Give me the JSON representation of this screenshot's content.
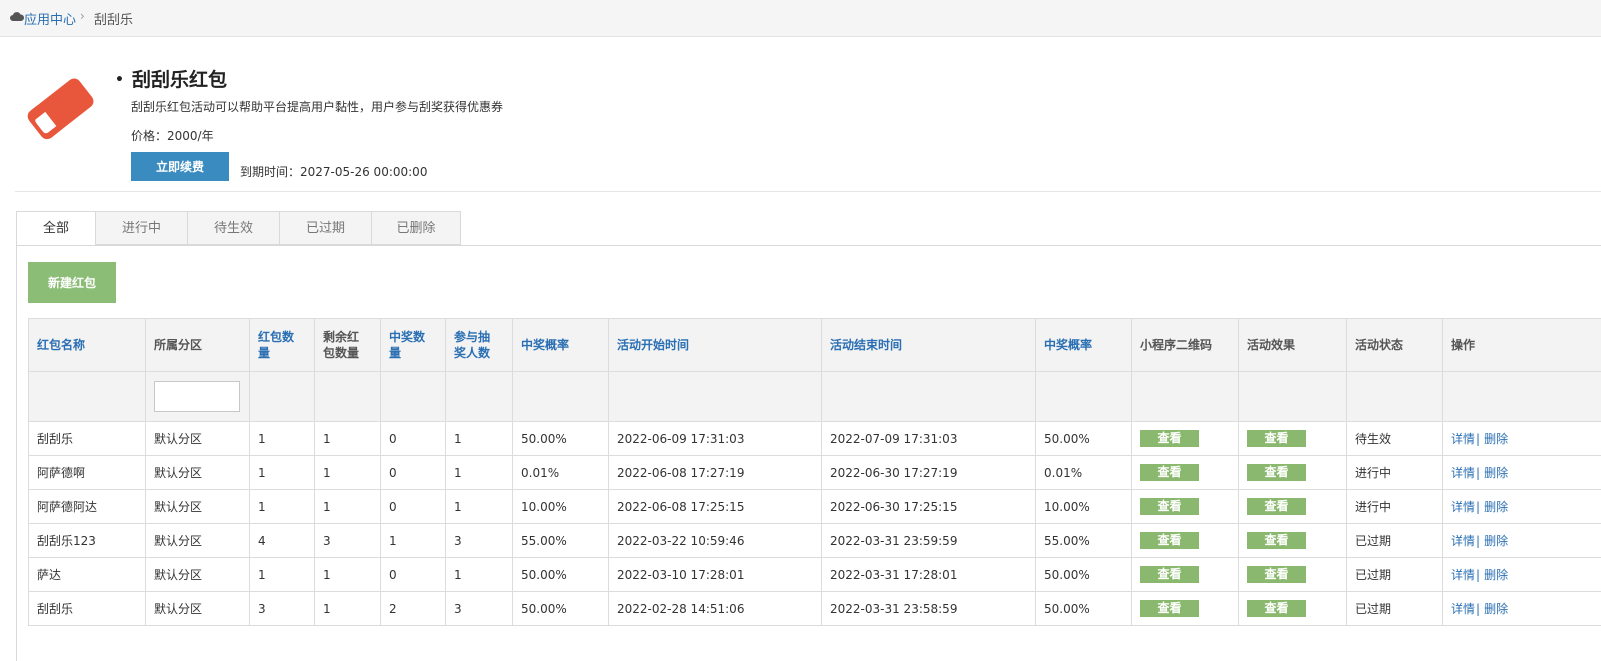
{
  "breadcrumb": {
    "home": "应用中心",
    "separator": "›",
    "current": "刮刮乐"
  },
  "app": {
    "title": "刮刮乐红包",
    "description": "刮刮乐红包活动可以帮助平台提高用户黏性，用户参与刮奖获得优惠券",
    "price": "价格：2000/年",
    "renew_label": "立即续费",
    "expire": "到期时间：2027-05-26 00:00:00",
    "logo_icon": "eraser-icon",
    "logo_color": "#e8573c"
  },
  "tabs": [
    "全部",
    "进行中",
    "待生效",
    "已过期",
    "已删除"
  ],
  "new_button": "新建红包",
  "table": {
    "headers": [
      "红包名称",
      "所属分区",
      "红包数量",
      "剩余红包数量",
      "中奖数量",
      "参与抽奖人数",
      "中奖概率",
      "活动开始时间",
      "活动结束时间",
      "中奖概率",
      "小程序二维码",
      "活动效果",
      "活动状态",
      "操作"
    ],
    "header_lines": [
      [
        "红包名称"
      ],
      [
        "所属分区"
      ],
      [
        "红包数",
        "量"
      ],
      [
        "剩余红",
        "包数量"
      ],
      [
        "中奖数",
        "量"
      ],
      [
        "参与抽",
        "奖人数"
      ],
      [
        "中奖概率"
      ],
      [
        "活动开始时间"
      ],
      [
        "活动结束时间"
      ],
      [
        "中奖概率"
      ],
      [
        "小程序二维码"
      ],
      [
        "活动效果"
      ],
      [
        "活动状态"
      ],
      [
        "操作"
      ]
    ],
    "view_label": "查看",
    "detail_label": "详情",
    "separator": "|",
    "delete_label": "删除",
    "rows": [
      [
        "刮刮乐",
        "默认分区",
        "1",
        "1",
        "0",
        "1",
        "50.00%",
        "2022-06-09 17:31:03",
        "2022-07-09 17:31:03",
        "50.00%",
        "待生效"
      ],
      [
        "阿萨德啊",
        "默认分区",
        "1",
        "1",
        "0",
        "1",
        "0.01%",
        "2022-06-08 17:27:19",
        "2022-06-30 17:27:19",
        "0.01%",
        "进行中"
      ],
      [
        "阿萨德阿达",
        "默认分区",
        "1",
        "1",
        "0",
        "1",
        "10.00%",
        "2022-06-08 17:25:15",
        "2022-06-30 17:25:15",
        "10.00%",
        "进行中"
      ],
      [
        "刮刮乐123",
        "默认分区",
        "4",
        "3",
        "1",
        "3",
        "55.00%",
        "2022-03-22 10:59:46",
        "2022-03-31 23:59:59",
        "55.00%",
        "已过期"
      ],
      [
        "萨达",
        "默认分区",
        "1",
        "1",
        "0",
        "1",
        "50.00%",
        "2022-03-10 17:28:01",
        "2022-03-31 17:28:01",
        "50.00%",
        "已过期"
      ],
      [
        "刮刮乐",
        "默认分区",
        "3",
        "1",
        "2",
        "3",
        "50.00%",
        "2022-02-28 14:51:06",
        "2022-03-31 23:58:59",
        "50.00%",
        "已过期"
      ]
    ]
  },
  "colors": {
    "primary": "#3a8bc0",
    "green": "#8bbd76",
    "link": "#2a6fb3"
  }
}
